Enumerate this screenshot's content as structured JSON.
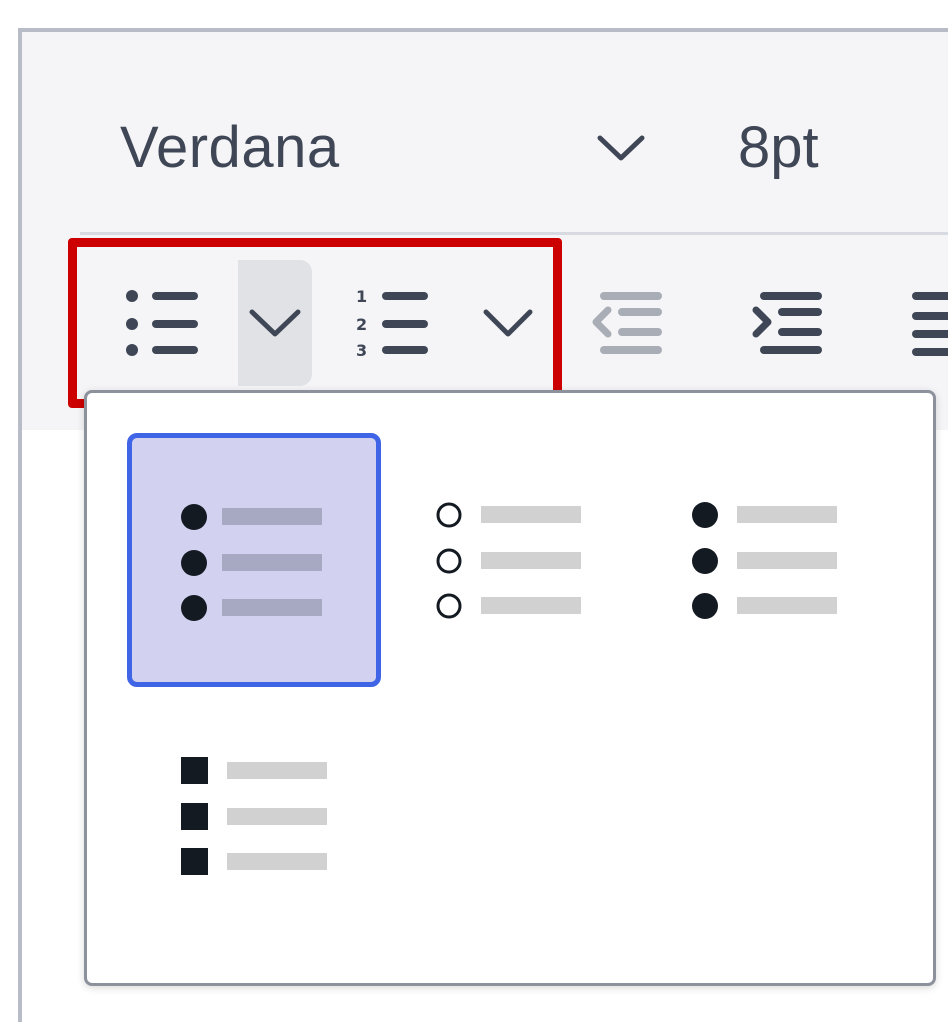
{
  "toolbar": {
    "font_family": "Verdana",
    "font_size": "8pt",
    "buttons": [
      {
        "name": "bullet-list-icon",
        "active": false
      },
      {
        "name": "bullet-list-dropdown",
        "active": true
      },
      {
        "name": "numbered-list-icon",
        "active": false
      },
      {
        "name": "numbered-list-dropdown",
        "active": false
      },
      {
        "name": "outdent-icon",
        "disabled": true
      },
      {
        "name": "indent-icon",
        "disabled": false
      },
      {
        "name": "align-icon",
        "disabled": false
      }
    ]
  },
  "bullet_styles": [
    {
      "style": "default",
      "marker": "filled-circle",
      "selected": true
    },
    {
      "style": "circle",
      "marker": "hollow-circle",
      "selected": false
    },
    {
      "style": "disc",
      "marker": "filled-circle",
      "selected": false
    },
    {
      "style": "square",
      "marker": "filled-square",
      "selected": false
    }
  ],
  "colors": {
    "accent": "#3f64e6",
    "highlight": "#cc0000",
    "selected_bg": "#d2d2f0",
    "icon": "#3f4756",
    "marker": "#141a22"
  }
}
